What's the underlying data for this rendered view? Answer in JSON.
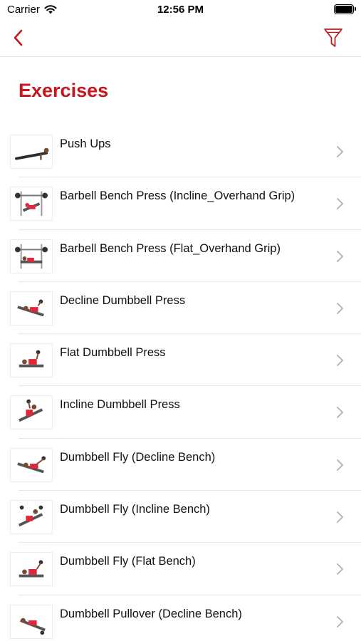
{
  "status_bar": {
    "carrier": "Carrier",
    "time": "12:56 PM"
  },
  "nav": {
    "back_icon": "chevron-left-icon",
    "filter_icon": "funnel-icon",
    "accent_color": "#c8161e"
  },
  "page": {
    "title": "Exercises"
  },
  "exercises": [
    {
      "label": "Push Ups"
    },
    {
      "label": "Barbell Bench Press (Incline_Overhand Grip)"
    },
    {
      "label": "Barbell Bench Press (Flat_Overhand Grip)"
    },
    {
      "label": "Decline Dumbbell Press"
    },
    {
      "label": "Flat Dumbbell Press"
    },
    {
      "label": "Incline Dumbbell Press"
    },
    {
      "label": "Dumbbell Fly (Decline Bench)"
    },
    {
      "label": "Dumbbell Fly (Incline Bench)"
    },
    {
      "label": "Dumbbell Fly (Flat Bench)"
    },
    {
      "label": "Dumbbell Pullover (Decline Bench)"
    }
  ]
}
